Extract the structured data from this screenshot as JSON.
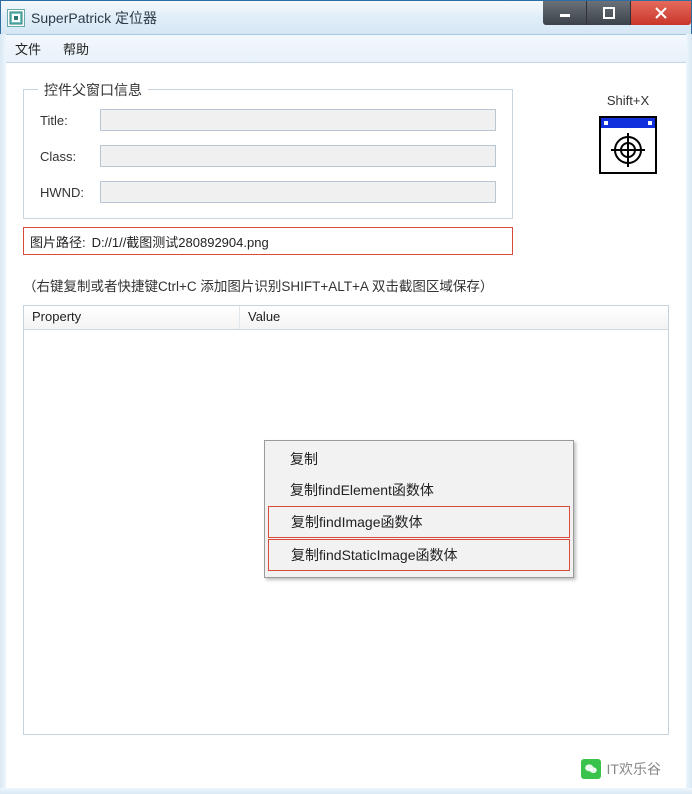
{
  "window": {
    "title": "SuperPatrick 定位器"
  },
  "menubar": {
    "file": "文件",
    "help": "帮助"
  },
  "groupbox": {
    "title": "控件父窗口信息",
    "labels": {
      "title": "Title:",
      "class": "Class:",
      "hwnd": "HWND:"
    },
    "values": {
      "title": "",
      "class": "",
      "hwnd": ""
    }
  },
  "image_path": {
    "label": "图片路径:",
    "value": "D://1//截图测试280892904.png"
  },
  "shortcut": {
    "label": "Shift+X"
  },
  "hint": "（右键复制或者快捷键Ctrl+C  添加图片识别SHIFT+ALT+A 双击截图区域保存）",
  "table": {
    "headers": {
      "property": "Property",
      "value": "Value"
    }
  },
  "context_menu": {
    "items": [
      {
        "label": "复制",
        "highlighted": false
      },
      {
        "label": "复制findElement函数体",
        "highlighted": false
      },
      {
        "label": "复制findImage函数体",
        "highlighted": true
      },
      {
        "label": "复制findStaticImage函数体",
        "highlighted": true
      }
    ]
  },
  "watermark": {
    "text": "IT欢乐谷"
  }
}
